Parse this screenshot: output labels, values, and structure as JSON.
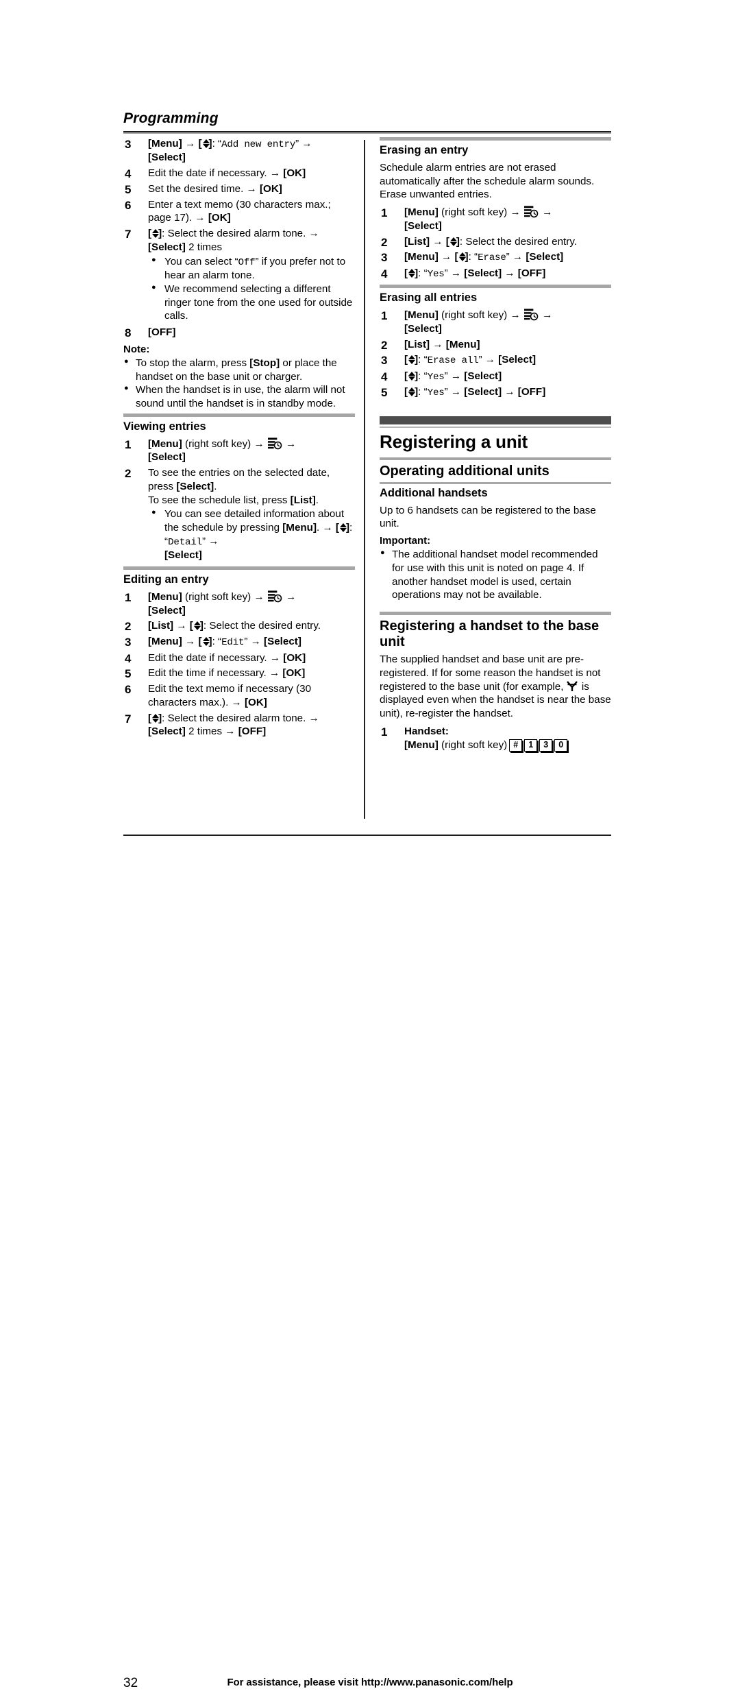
{
  "running_head": "Programming",
  "page_number": "32",
  "footer_text": "For assistance, please visit http://www.panasonic.com/help",
  "left_column": {
    "schedule_steps": [
      {
        "num": "3",
        "html_key": "[Menu]",
        "text": " → [↕]: “Add new entry” → [Select]"
      },
      {
        "num": "4",
        "text": "Edit the date if necessary. → [OK]"
      },
      {
        "num": "5",
        "text": "Set the desired time. → [OK]"
      },
      {
        "num": "6",
        "text": "Enter a text memo (30 characters max.; page 17). → [OK]"
      },
      {
        "num": "7",
        "text": "[↕]: Select the desired alarm tone. → [Select] 2 times"
      },
      {
        "num": "8",
        "text": "[OFF]"
      }
    ],
    "step3_tail": "[Select]",
    "step3_quoted": "Add new entry",
    "step4_text": "Edit the date if necessary.",
    "step4_key": "[OK]",
    "step5_text": "Set the desired time.",
    "step5_key": "[OK]",
    "step6_text": "Enter a text memo (30 characters max.; page 17).",
    "step6_key": "[OK]",
    "step7_text": "Select the desired alarm tone.",
    "step7_key": "[Select]",
    "step7_tail": "2 times",
    "step7_bullets": [
      "You can select “Off” if you prefer not to hear an alarm tone.",
      "We recommend selecting a different ringer tone from the one used for outside calls."
    ],
    "step7_bullet1_pre": "You can select “",
    "step7_bullet1_mono": "Off",
    "step7_bullet1_post": "” if you prefer not to hear an alarm tone.",
    "step7_bullet2": "We recommend selecting a different ringer tone from the one used for outside calls.",
    "step8_key": "[OFF]",
    "note_label": "Note:",
    "note_bullet1_pre": "To stop the alarm, press ",
    "note_bullet1_key": "[Stop]",
    "note_bullet1_post": " or place the handset on the base unit or charger.",
    "note_bullet2": "When the handset is in use, the alarm will not sound until the handset is in standby mode.",
    "viewing": {
      "heading": "Viewing entries",
      "step1_num": "1",
      "step1_key": "[Menu]",
      "step1_paren": "(right soft key)",
      "step1_tail": "[Select]",
      "step2_num": "2",
      "step2_line1_pre": "To see the entries on the selected date, press ",
      "step2_line1_key": "[Select]",
      "step2_line2_pre": "To see the schedule list, press ",
      "step2_line2_key": "[List]",
      "step2_bullet_pre": "You can see detailed information about the schedule by pressing ",
      "step2_bullet_key1": "[Menu]",
      "step2_bullet_mid": ". → [↕]: “",
      "step2_bullet_mono": "Detail",
      "step2_bullet_tail": "[Select]"
    },
    "editing": {
      "heading": "Editing an entry",
      "step1_num": "1",
      "step1_key": "[Menu]",
      "step1_paren": "(right soft key)",
      "step1_tail": "[Select]",
      "step2_num": "2",
      "step2_key1": "[List]",
      "step2_text": "Select the desired entry.",
      "step3_num": "3",
      "step3_key1": "[Menu]",
      "step3_mono": "Edit",
      "step3_key2": "[Select]",
      "step4_num": "4",
      "step4_text": "Edit the date if necessary.",
      "step4_key": "[OK]",
      "step5_num": "5",
      "step5_text": "Edit the time if necessary.",
      "step5_key": "[OK]",
      "step6_num": "6",
      "step6_text": "Edit the text memo if necessary (30 characters max.).",
      "step6_key": "[OK]",
      "step7_num": "7",
      "step7_text": "Select the desired alarm tone.",
      "step7_key1": "[Select]",
      "step7_mid": "2 times",
      "step7_key2": "[OFF]"
    }
  },
  "right_column": {
    "erasing_entry": {
      "heading": "Erasing an entry",
      "intro": "Schedule alarm entries are not erased automatically after the schedule alarm sounds. Erase unwanted entries.",
      "step1_num": "1",
      "step1_key": "[Menu]",
      "step1_paren": "(right soft key)",
      "step1_tail": "[Select]",
      "step2_num": "2",
      "step2_key1": "[List]",
      "step2_text": "Select the desired entry.",
      "step3_num": "3",
      "step3_key1": "[Menu]",
      "step3_mono": "Erase",
      "step3_key2": "[Select]",
      "step4_num": "4",
      "step4_mono": "Yes",
      "step4_key1": "[Select]",
      "step4_key2": "[OFF]"
    },
    "erasing_all": {
      "heading": "Erasing all entries",
      "step1_num": "1",
      "step1_key": "[Menu]",
      "step1_paren": "(right soft key)",
      "step1_tail": "[Select]",
      "step2_num": "2",
      "step2_key1": "[List]",
      "step2_key2": "[Menu]",
      "step3_num": "3",
      "step3_mono": "Erase all",
      "step3_key": "[Select]",
      "step4_num": "4",
      "step4_mono": "Yes",
      "step4_key": "[Select]",
      "step5_num": "5",
      "step5_mono": "Yes",
      "step5_key1": "[Select]",
      "step5_key2": "[OFF]"
    },
    "chapter_title": "Registering a unit",
    "section_title": "Operating additional units",
    "additional_handsets": {
      "heading": "Additional handsets",
      "body": "Up to 6 handsets can be registered to the base unit.",
      "important_label": "Important:",
      "important_bullet": "The additional handset model recommended for use with this unit is noted on page 4. If another handset model is used, certain operations may not be available."
    },
    "registering_handset": {
      "heading": "Registering a handset to the base unit",
      "body_pre": "The supplied handset and base unit are pre-registered. If for some reason the handset is not registered to the base unit (for example, ",
      "body_post": " is displayed even when the handset is near the base unit), re-register the handset.",
      "step1_num": "1",
      "step1_label": "Handset:",
      "step1_key": "[Menu]",
      "step1_paren": "(right soft key)",
      "step1_dialkeys": [
        "#",
        "1",
        "3",
        "0"
      ]
    }
  },
  "icons": {
    "schedule": "schedule-list-clock-icon",
    "antenna": "no-signal-antenna-icon",
    "nav": "navigator-up-down-key-icon"
  },
  "colors": {
    "text": "#000000",
    "bar_gray": "#a6a6a6",
    "bar_dark": "#4d4d4d",
    "rule_dark": "#1a1a1a"
  }
}
